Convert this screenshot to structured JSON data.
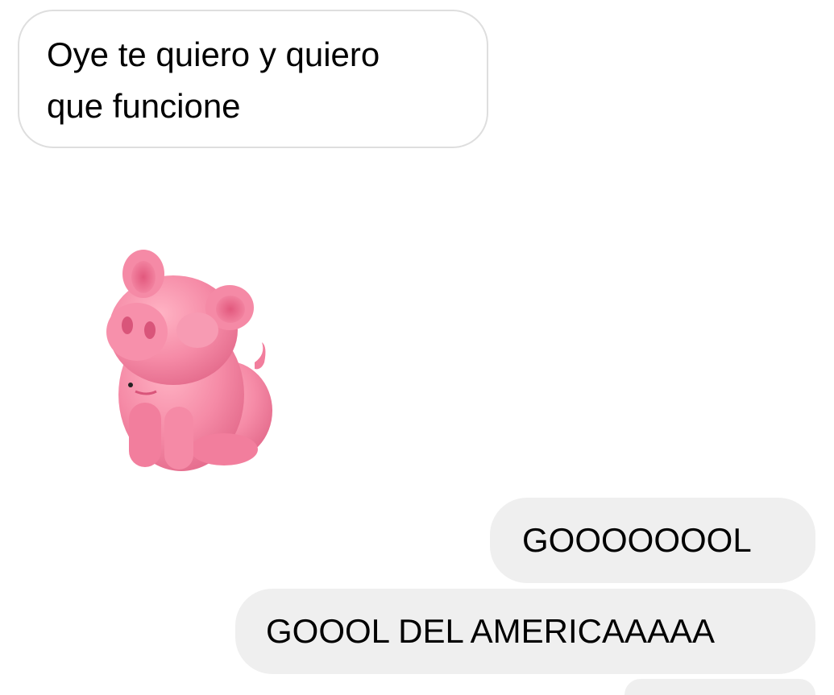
{
  "conversation": {
    "messages": [
      {
        "direction": "received",
        "type": "text",
        "line1": "Oye te quiero y quiero",
        "line2": "que funcione"
      },
      {
        "direction": "received",
        "type": "sticker",
        "sticker_icon": "pink-pig-sticker-icon"
      },
      {
        "direction": "sent",
        "type": "text",
        "text": "GOOOOOOOL"
      },
      {
        "direction": "sent",
        "type": "text",
        "text": "GOOOL DEL AMERICAAAAA"
      }
    ]
  },
  "colors": {
    "received_bubble_bg": "#ffffff",
    "received_bubble_border": "#dedede",
    "sent_bubble_bg": "#efefef",
    "sticker_pink": "#f58aa6"
  }
}
